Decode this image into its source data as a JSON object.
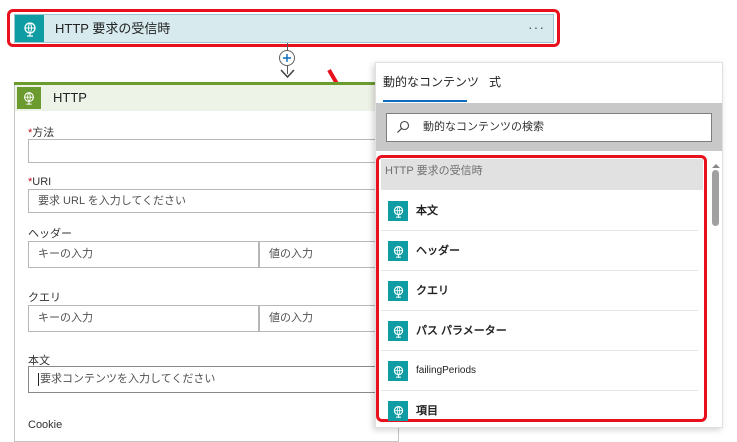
{
  "trigger": {
    "title": "HTTP 要求の受信時",
    "more": "···"
  },
  "http_action": {
    "title": "HTTP",
    "method": {
      "label": "方法",
      "required": "*",
      "value": ""
    },
    "uri": {
      "label": "URI",
      "required": "*",
      "placeholder": "要求 URL を入力してください"
    },
    "headers": {
      "label": "ヘッダー",
      "key_placeholder": "キーの入力",
      "value_placeholder": "値の入力"
    },
    "queries": {
      "label": "クエリ",
      "key_placeholder": "キーの入力",
      "value_placeholder": "値の入力"
    },
    "body": {
      "label": "本文",
      "placeholder": "要求コンテンツを入力してください"
    },
    "cookie": {
      "label": "Cookie"
    }
  },
  "panel": {
    "tabs": [
      {
        "label": "動的なコンテンツ",
        "active": true
      },
      {
        "label": "式",
        "active": false
      }
    ],
    "search": {
      "placeholder": "動的なコンテンツの検索"
    },
    "group_title": "HTTP 要求の受信時",
    "items": [
      {
        "label": "本文",
        "icon": "globe-icon"
      },
      {
        "label": "ヘッダー",
        "icon": "globe-icon"
      },
      {
        "label": "クエリ",
        "icon": "globe-icon"
      },
      {
        "label": "パス パラメーター",
        "icon": "globe-icon"
      },
      {
        "label": "failingPeriods",
        "icon": "globe-icon"
      },
      {
        "label": "項目",
        "icon": "globe-icon"
      }
    ]
  },
  "colors": {
    "highlight": "#e8101c",
    "trigger_teal": "#0f9ca3",
    "http_green": "#6b9b2f",
    "tab_accent": "#0f6cbd"
  }
}
